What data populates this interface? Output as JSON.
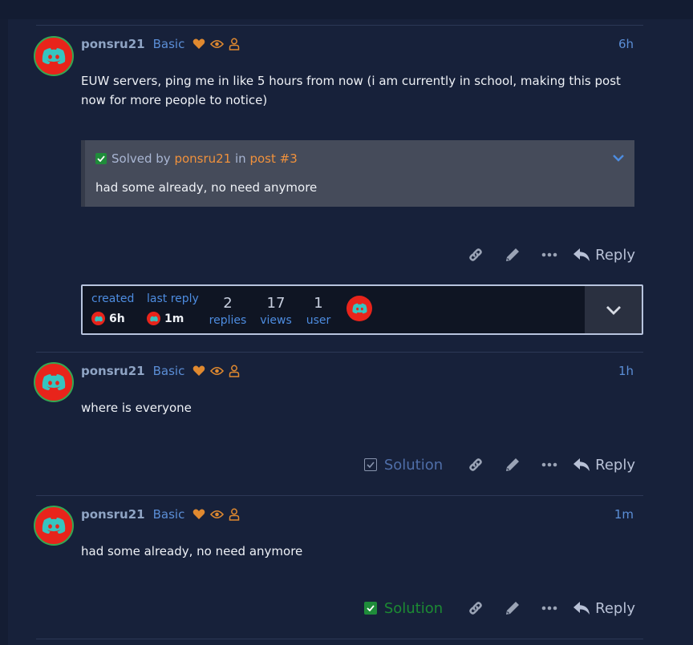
{
  "colors": {
    "background": "#17213a",
    "link_blue": "#5b8ed6",
    "orange": "#f0913c",
    "green": "#1f8c3a",
    "avatar_red": "#e8241b"
  },
  "posts": [
    {
      "username": "ponsru21",
      "flair": "Basic",
      "badges": [
        "heart-icon",
        "eye-icon",
        "person-icon"
      ],
      "time": "6h",
      "body": "EUW servers, ping me in like 5 hours from now (i am currently in school, making this post now for more people to notice)",
      "solved": {
        "prefix": "Solved by",
        "user": "ponsru21",
        "in": "in",
        "post_link": "post #3",
        "quote": "had some already, no need anymore"
      },
      "actions": {
        "reply": "Reply"
      }
    },
    {
      "username": "ponsru21",
      "flair": "Basic",
      "time": "1h",
      "body": "where is everyone",
      "actions": {
        "solution": "Solution",
        "solution_checked": false,
        "reply": "Reply"
      }
    },
    {
      "username": "ponsru21",
      "flair": "Basic",
      "time": "1m",
      "body": "had some already, no need anymore",
      "actions": {
        "solution": "Solution",
        "solution_checked": true,
        "reply": "Reply"
      }
    }
  ],
  "topic_map": {
    "created_label": "created",
    "created_value": "6h",
    "last_reply_label": "last reply",
    "last_reply_value": "1m",
    "replies_count": "2",
    "replies_label": "replies",
    "views_count": "17",
    "views_label": "views",
    "users_count": "1",
    "users_label": "user"
  }
}
